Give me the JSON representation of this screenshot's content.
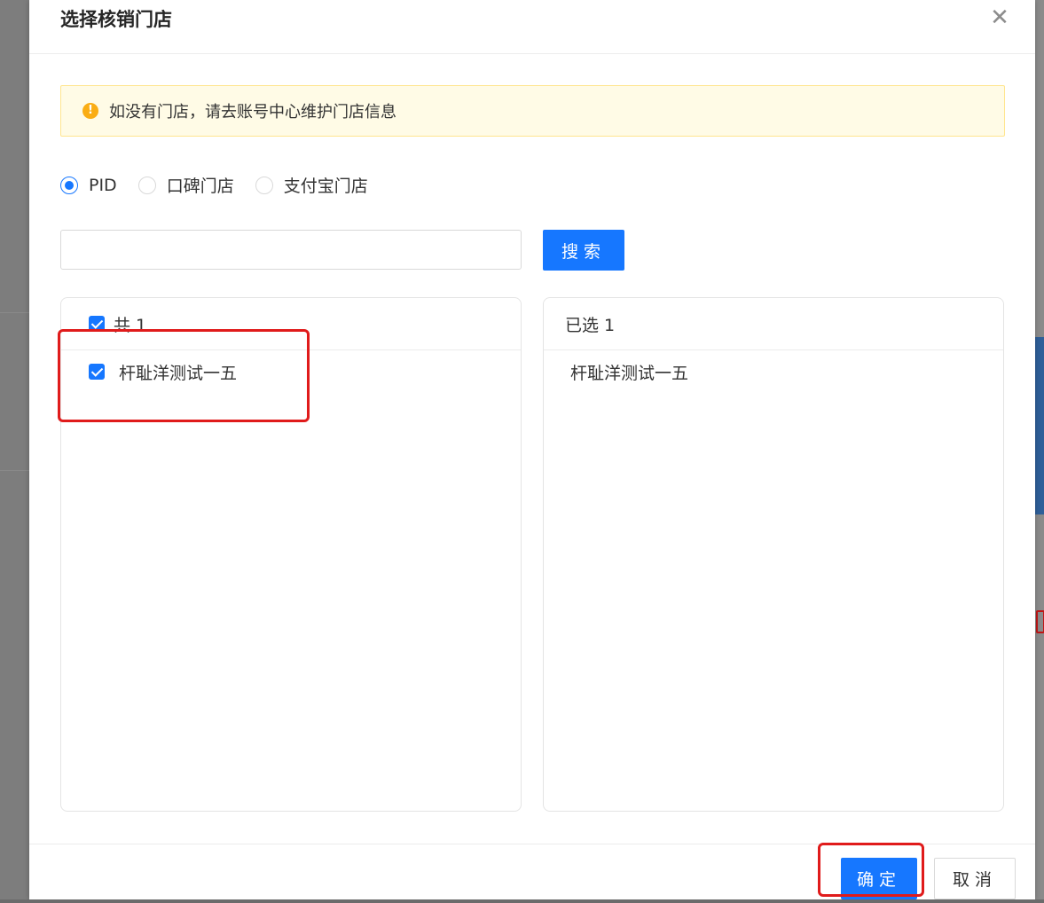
{
  "modal": {
    "title": "选择核销门店",
    "close_icon": "close-icon"
  },
  "alert": {
    "icon": "exclamation-icon",
    "icon_glyph": "!",
    "text": "如没有门店，请去账号中心维护门店信息"
  },
  "store_type": {
    "options": [
      "PID",
      "口碑门店",
      "支付宝门店"
    ],
    "selected": "PID"
  },
  "search": {
    "value": "",
    "button_label": "搜索"
  },
  "left_list": {
    "header": "共 1",
    "items": [
      "杆耻洋测试一五"
    ]
  },
  "right_list": {
    "header": "已选 1",
    "items": [
      "杆耻洋测试一五"
    ]
  },
  "footer": {
    "ok_label": "确定",
    "cancel_label": "取消"
  },
  "colors": {
    "primary": "#1677ff",
    "warning": "#faad14",
    "highlight": "#e01b1b"
  }
}
